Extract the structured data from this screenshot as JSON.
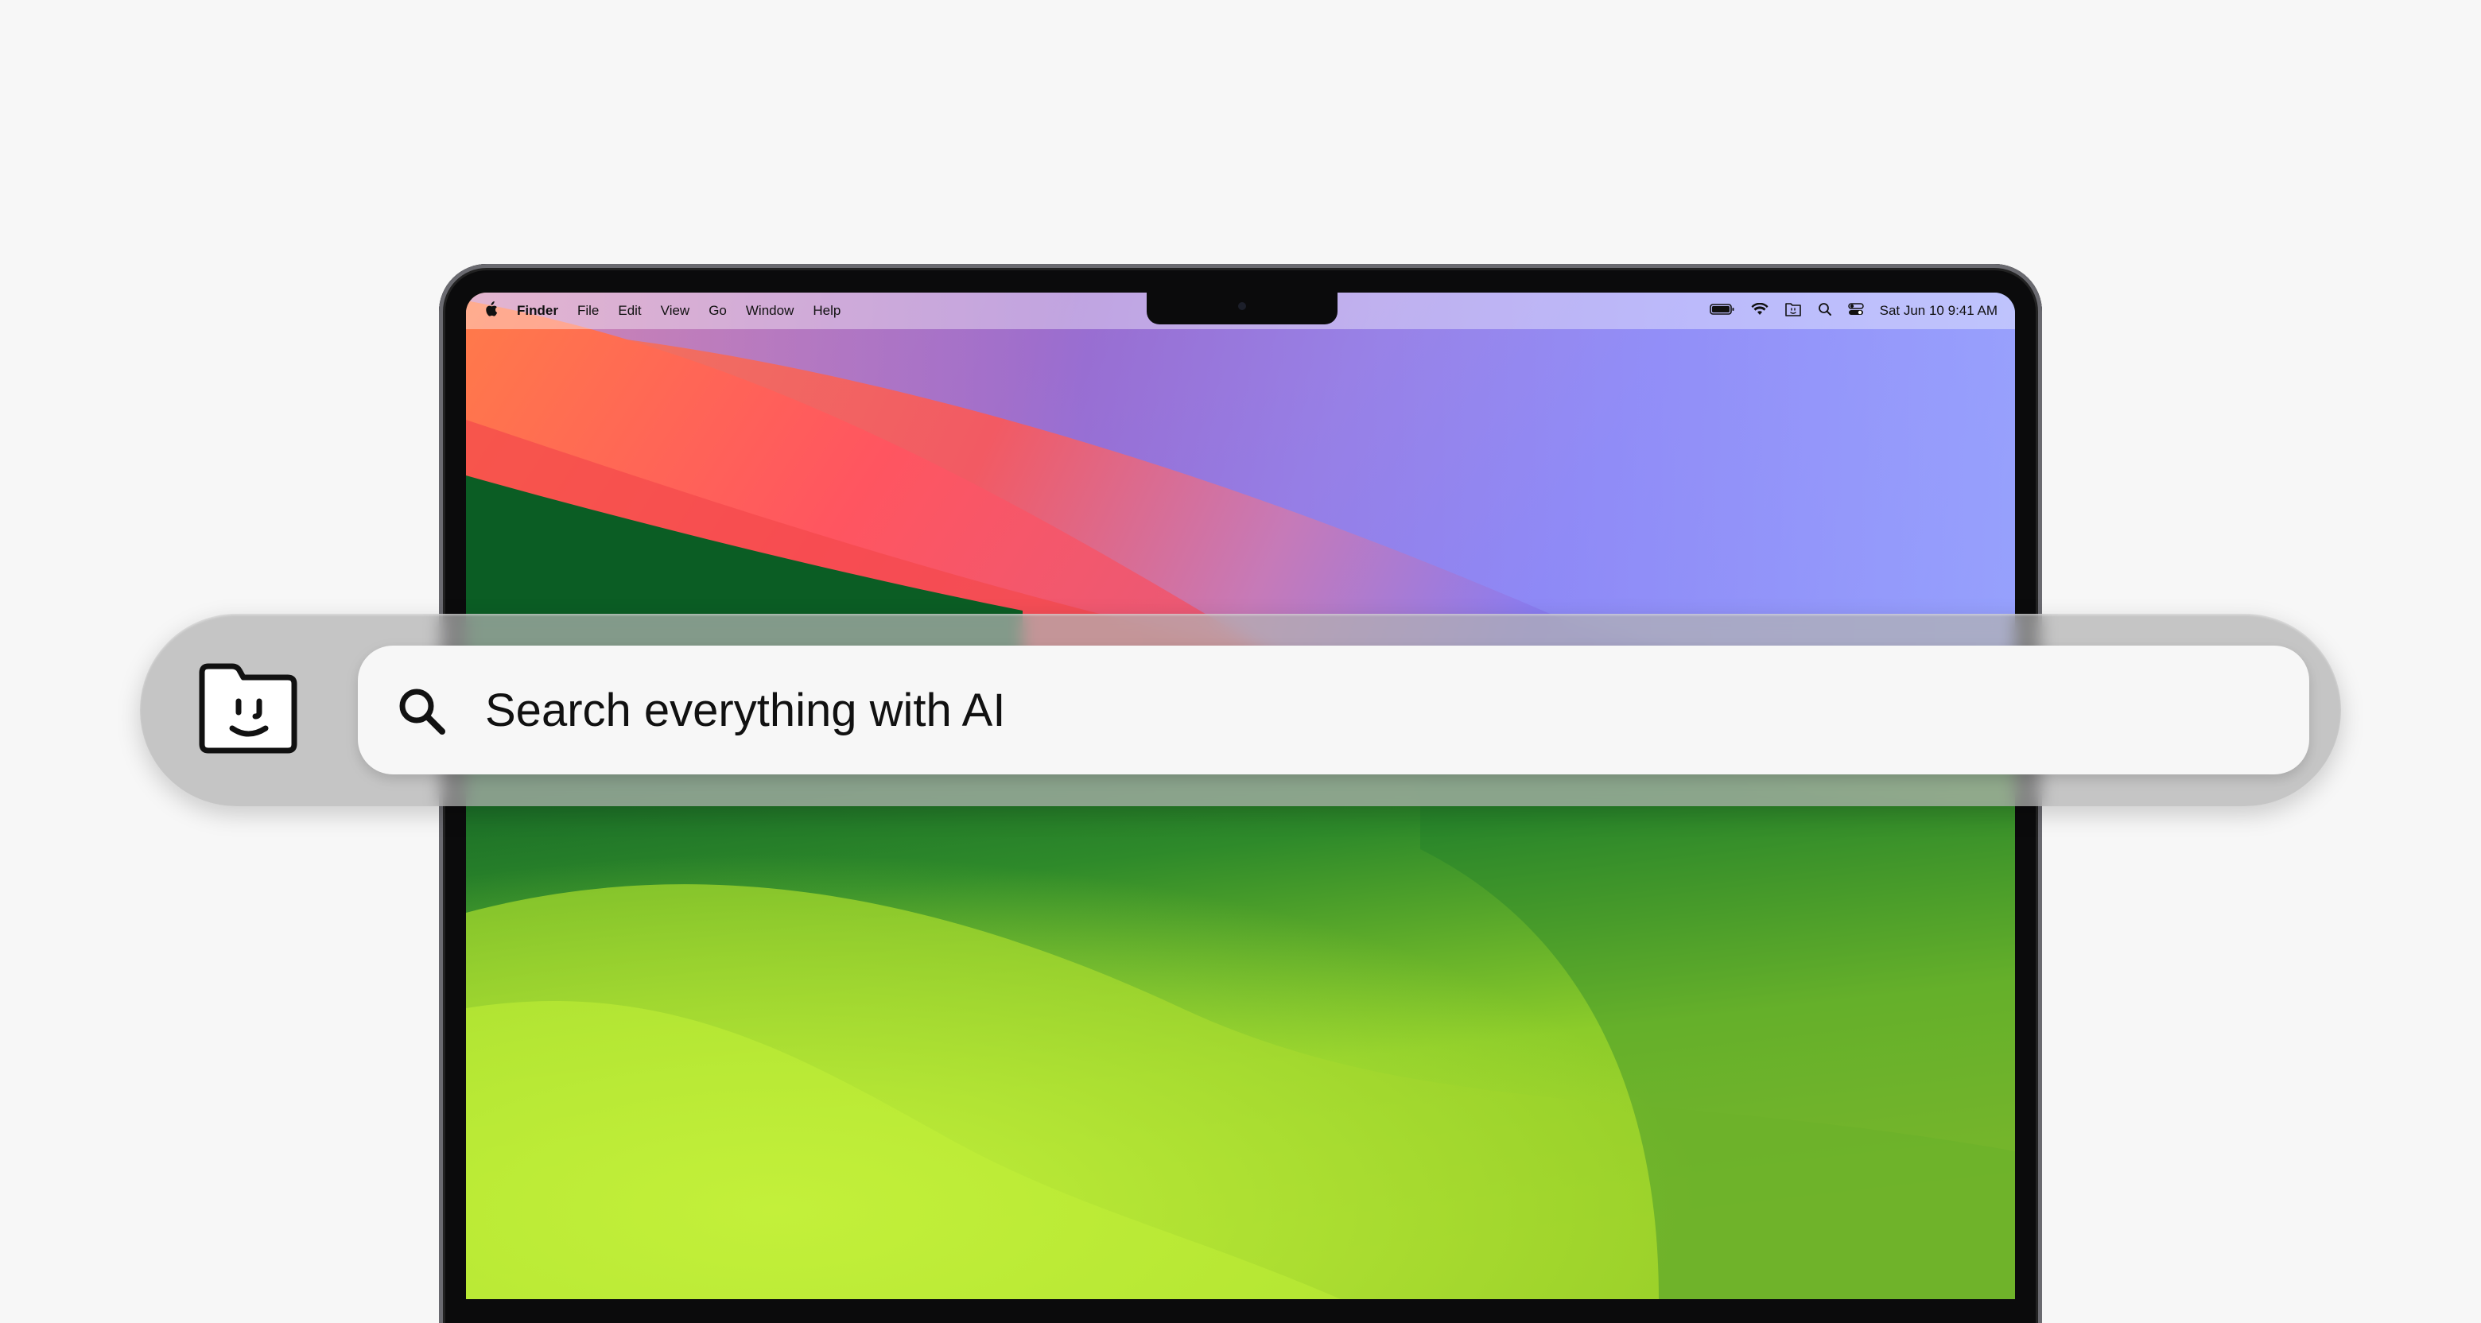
{
  "menubar": {
    "apple_icon": "apple-icon",
    "app_name": "Finder",
    "menus": [
      "File",
      "Edit",
      "View",
      "Go",
      "Window",
      "Help"
    ],
    "status_icons": [
      "battery-icon",
      "wifi-icon",
      "app-status-icon",
      "spotlight-icon",
      "control-center-icon"
    ],
    "datetime": "Sat Jun 10  9:41 AM"
  },
  "ai_search": {
    "logo_icon": "folder-face-icon",
    "search_icon": "search-icon",
    "placeholder": "Search everything with AI"
  },
  "colors": {
    "background": "#f7f7f7",
    "search_band": "#b2b2b2",
    "search_field": "#f7f7f7",
    "wallpaper_green": "#9ad42a",
    "wallpaper_red": "#f55b5b",
    "wallpaper_blue": "#7a84f5"
  }
}
